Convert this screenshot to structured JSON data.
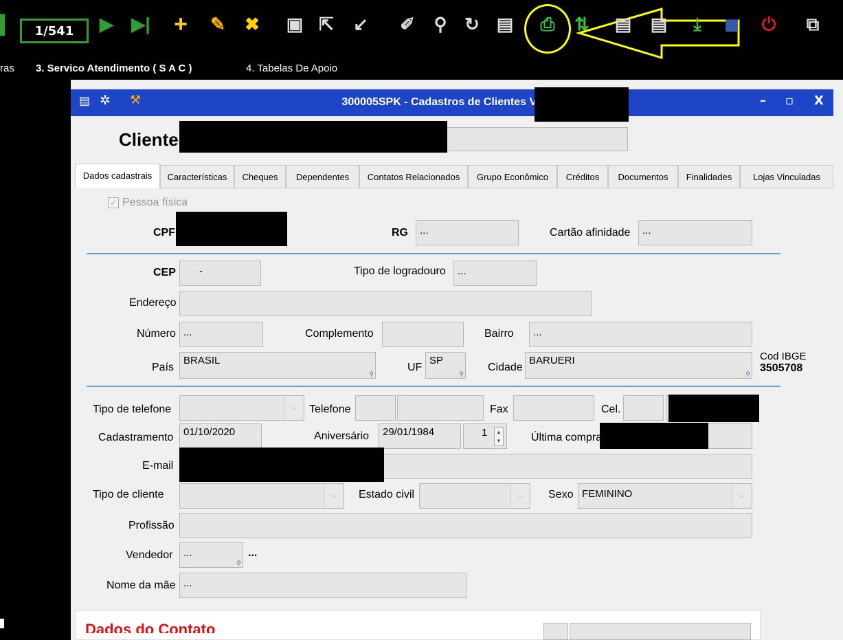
{
  "toolbar": {
    "record_counter": "1/541",
    "icons": [
      "first-record-icon",
      "next-record-icon",
      "last-record-icon",
      "add-icon",
      "edit-icon",
      "delete-icon",
      "save-icon",
      "arrow-icon",
      "confirm-icon",
      "clear-icon",
      "search-icon",
      "refresh-icon",
      "preview-icon",
      "print-icon",
      "sort-icon",
      "add-detail-icon",
      "remove-detail-icon",
      "download-icon",
      "shield-icon",
      "power-icon",
      "window-switch-icon"
    ],
    "highlight_color": "#ffff00"
  },
  "menubar": {
    "left_partial": "ras",
    "item3": "3. Servico Atendimento ( S A C )",
    "item4": "4. Tabelas De Apoio"
  },
  "window": {
    "title": "300005SPK - Cadastros de Clientes Varejo",
    "controls": {
      "minimize": "–",
      "maximize": "▫",
      "close": "X"
    },
    "heading": "Cliente"
  },
  "tabs": [
    {
      "label": "Dados cadastrais",
      "active": true
    },
    {
      "label": "Características"
    },
    {
      "label": "Cheques"
    },
    {
      "label": "Dependentes"
    },
    {
      "label": "Contatos Relacionados"
    },
    {
      "label": "Grupo Econômico"
    },
    {
      "label": "Créditos"
    },
    {
      "label": "Documentos"
    },
    {
      "label": "Finalidades"
    },
    {
      "label": "Lojas Vinculadas"
    }
  ],
  "form": {
    "pessoa_fisica": "Pessoa física",
    "cpf_label": "CPF",
    "rg_label": "RG",
    "rg_value": "...",
    "cartao_label": "Cartão afinidade",
    "cartao_value": "...",
    "cep_label": "CEP",
    "cep_value": "-",
    "tipo_logradouro_label": "Tipo de logradouro",
    "tipo_logradouro_value": "...",
    "endereco_label": "Endereço",
    "endereco_value": "",
    "numero_label": "Número",
    "numero_value": "...",
    "complemento_label": "Complemento",
    "complemento_value": "",
    "bairro_label": "Bairro",
    "bairro_value": "...",
    "pais_label": "País",
    "pais_value": "BRASIL",
    "uf_label": "UF",
    "uf_value": "SP",
    "cidade_label": "Cidade",
    "cidade_value": "BARUERI",
    "cod_ibge_label": "Cod IBGE",
    "cod_ibge_value": "3505708",
    "tipo_telefone_label": "Tipo de telefone",
    "telefone_label": "Telefone",
    "fax_label": "Fax",
    "cel_label": "Cel.",
    "cadastramento_label": "Cadastramento",
    "cadastramento_value": "01/10/2020",
    "aniversario_label": "Aniversário",
    "aniversario_value": "29/01/1984",
    "spin_value": "1",
    "ultima_compra_label": "Última compra",
    "email_label": "E-mail",
    "tipo_cliente_label": "Tipo de cliente",
    "estado_civil_label": "Estado civil",
    "sexo_label": "Sexo",
    "sexo_value": "FEMININO",
    "profissao_label": "Profissão",
    "vendedor_label": "Vendedor",
    "vendedor_value": "...",
    "vendedor_extra": "...",
    "nome_mae_label": "Nome da mãe",
    "nome_mae_value": "..."
  },
  "bottom_section_partial": "Dados do Contato"
}
